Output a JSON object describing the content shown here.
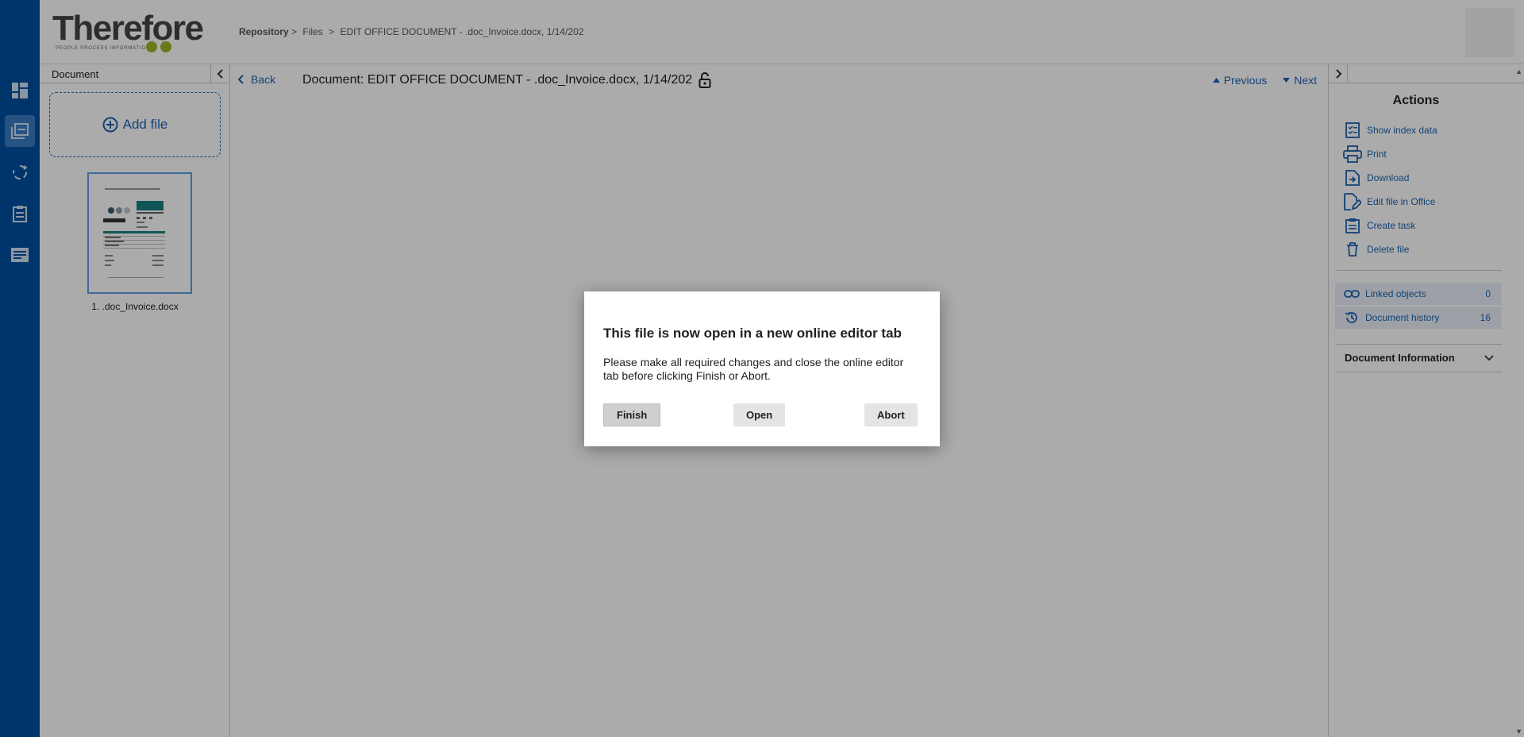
{
  "header": {
    "logo_text": "Therefore",
    "logo_tagline": "PEOPLE  PROCESS  INFORMATION",
    "breadcrumb": [
      "Repository",
      "Files",
      "EDIT OFFICE DOCUMENT - .doc_Invoice.docx, 1/14/202"
    ],
    "breadcrumb_sep": ">"
  },
  "nav": {
    "icons": [
      "dashboard-icon",
      "documents-icon",
      "workflow-icon",
      "tasks-icon",
      "list-icon"
    ],
    "active_index": 1
  },
  "left_panel": {
    "title": "Document",
    "add_file_label": "Add file",
    "files": [
      {
        "caption": "1. .doc_Invoice.docx"
      }
    ]
  },
  "main": {
    "back_label": "Back",
    "document_title": "Document: EDIT OFFICE DOCUMENT - .doc_Invoice.docx, 1/14/202",
    "previous_label": "Previous",
    "next_label": "Next"
  },
  "right_panel": {
    "actions_title": "Actions",
    "actions": [
      {
        "label": "Show index data",
        "icon": "index-data-icon"
      },
      {
        "label": "Print",
        "icon": "printer-icon"
      },
      {
        "label": "Download",
        "icon": "download-icon"
      },
      {
        "label": "Edit file in Office",
        "icon": "edit-file-icon"
      },
      {
        "label": "Create task",
        "icon": "task-icon"
      },
      {
        "label": "Delete file",
        "icon": "trash-icon"
      }
    ],
    "linked_objects_label": "Linked objects",
    "linked_objects_count": "0",
    "document_history_label": "Document history",
    "document_history_count": "16",
    "document_information_label": "Document Information"
  },
  "dialog": {
    "title": "This file is now open in a new online editor tab",
    "message": "Please make all required changes and close the online editor tab before clicking Finish or Abort.",
    "finish_label": "Finish",
    "open_label": "Open",
    "abort_label": "Abort"
  },
  "colors": {
    "nav_bg": "#0050a0",
    "accent": "#1d63b0",
    "logo_dots": "#9cb82a"
  }
}
